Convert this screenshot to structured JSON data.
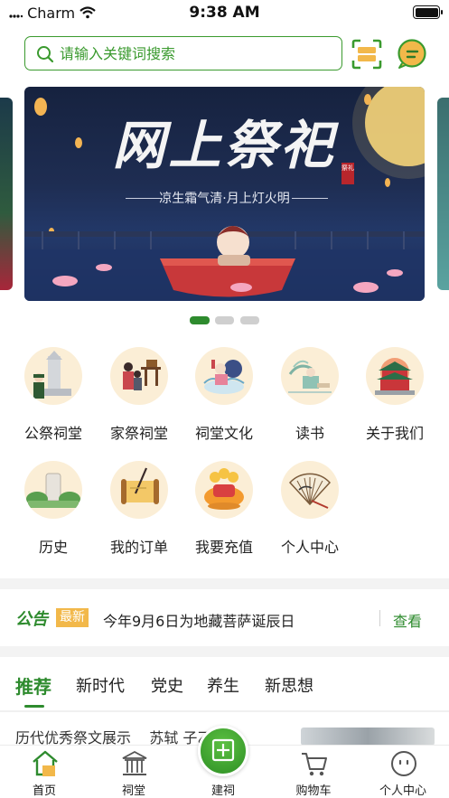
{
  "status_bar": {
    "carrier": "Charm",
    "time": "9:38 AM"
  },
  "search": {
    "placeholder": "请输入关键词搜索",
    "icons": [
      "search-icon",
      "scan-icon",
      "message-icon"
    ]
  },
  "banner": {
    "title": "网上祭祀",
    "seal_text": "祭礼",
    "subtitle": "凉生霜气清·月上灯火明",
    "active_index": 0,
    "page_count": 3
  },
  "grid": [
    {
      "label": "公祭祠堂",
      "icon": "memorial-icon"
    },
    {
      "label": "家祭祠堂",
      "icon": "family-worship-icon"
    },
    {
      "label": "祠堂文化",
      "icon": "culture-icon"
    },
    {
      "label": "读书",
      "icon": "reading-icon"
    },
    {
      "label": "关于我们",
      "icon": "temple-icon"
    },
    {
      "label": "历史",
      "icon": "history-icon"
    },
    {
      "label": "我的订单",
      "icon": "scroll-icon"
    },
    {
      "label": "我要充值",
      "icon": "treasure-icon"
    },
    {
      "label": "个人中心",
      "icon": "fan-icon"
    }
  ],
  "notice": {
    "tag": "公告",
    "badge": "最新",
    "text": "今年9月6日为地藏菩萨诞辰日",
    "more": "查看"
  },
  "tabs": [
    {
      "label": "推荐",
      "active": true
    },
    {
      "label": "新时代",
      "active": false
    },
    {
      "label": "党史",
      "active": false
    },
    {
      "label": "养生",
      "active": false
    },
    {
      "label": "新思想",
      "active": false
    }
  ],
  "article_peek": "历代优秀祭文展示    苏轼 子乙",
  "nav": [
    {
      "label": "首页",
      "icon": "home-icon",
      "active": true
    },
    {
      "label": "祠堂",
      "icon": "hall-icon",
      "active": false
    },
    {
      "label": "建祠",
      "icon": "build-hall-icon",
      "active": false
    },
    {
      "label": "购物车",
      "icon": "cart-icon",
      "active": false
    },
    {
      "label": "个人中心",
      "icon": "profile-icon",
      "active": false
    }
  ],
  "colors": {
    "brand_green": "#2e8b2e",
    "badge_orange": "#f2b84a",
    "icon_bg": "#fbeed6"
  }
}
